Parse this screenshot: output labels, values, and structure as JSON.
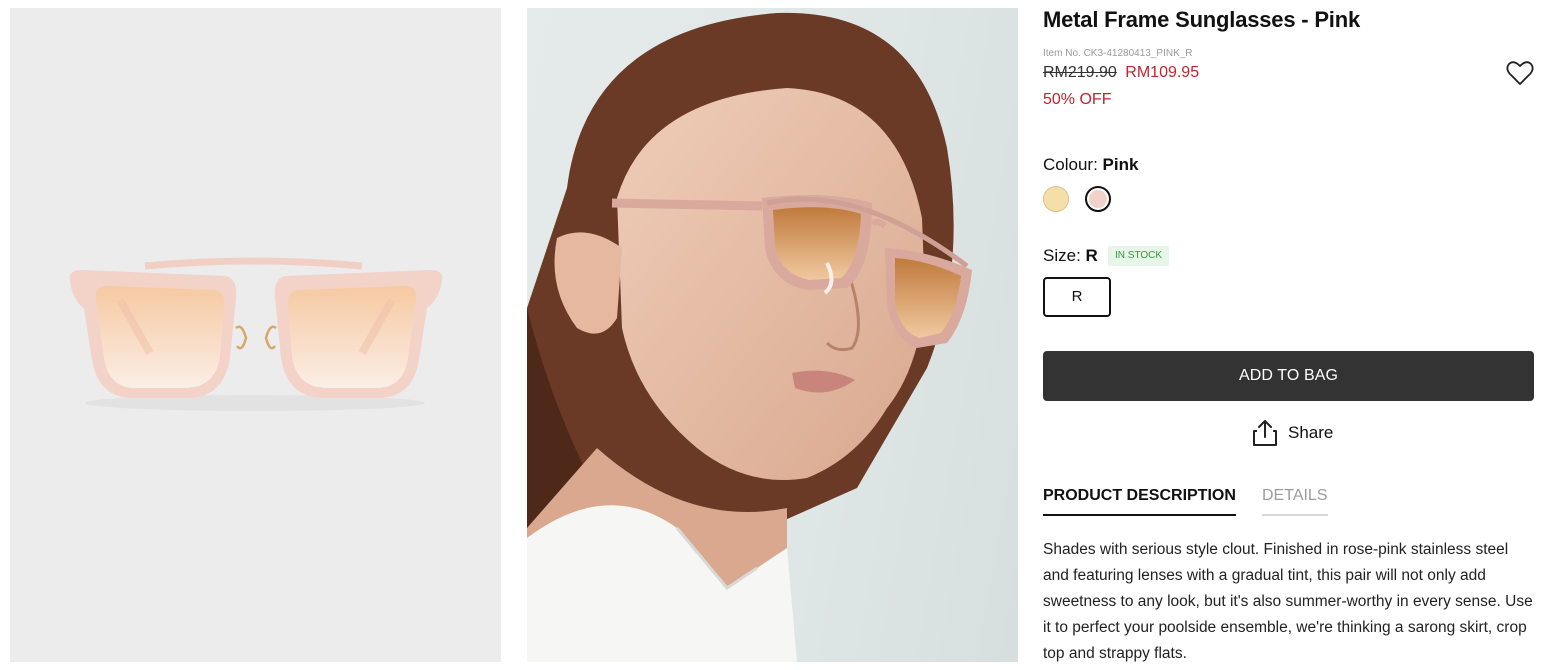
{
  "product": {
    "title": "Metal Frame Sunglasses - Pink",
    "item_no": "Item No. CK3-41280413_PINK_R",
    "old_price": "RM219.90",
    "new_price": "RM109.95",
    "discount": "50% OFF"
  },
  "colour": {
    "label": "Colour:",
    "selected": "Pink",
    "swatches": [
      {
        "name": "Gold",
        "color": "#f4dfa8"
      },
      {
        "name": "Pink",
        "color": "#f1d2c9"
      }
    ]
  },
  "size": {
    "label": "Size:",
    "selected": "R",
    "stock_status": "IN STOCK",
    "options": [
      "R"
    ]
  },
  "actions": {
    "add_to_bag": "ADD TO BAG",
    "share": "Share"
  },
  "tabs": [
    {
      "label": "PRODUCT DESCRIPTION",
      "active": true
    },
    {
      "label": "DETAILS",
      "active": false
    }
  ],
  "description": "Shades with serious style clout. Finished in rose-pink stainless steel and featuring lenses with a gradual tint, this pair will not only add sweetness to any look, but it's also summer-worthy in every sense. Use it to perfect your poolside ensemble, we're thinking a sarong skirt, crop top and strappy flats.",
  "icons": {
    "wishlist": "heart-icon",
    "share": "share-upload-icon"
  },
  "colors": {
    "accent_red": "#c0262d",
    "button_dark": "#333333",
    "stock_green": "#2e9b3c"
  }
}
